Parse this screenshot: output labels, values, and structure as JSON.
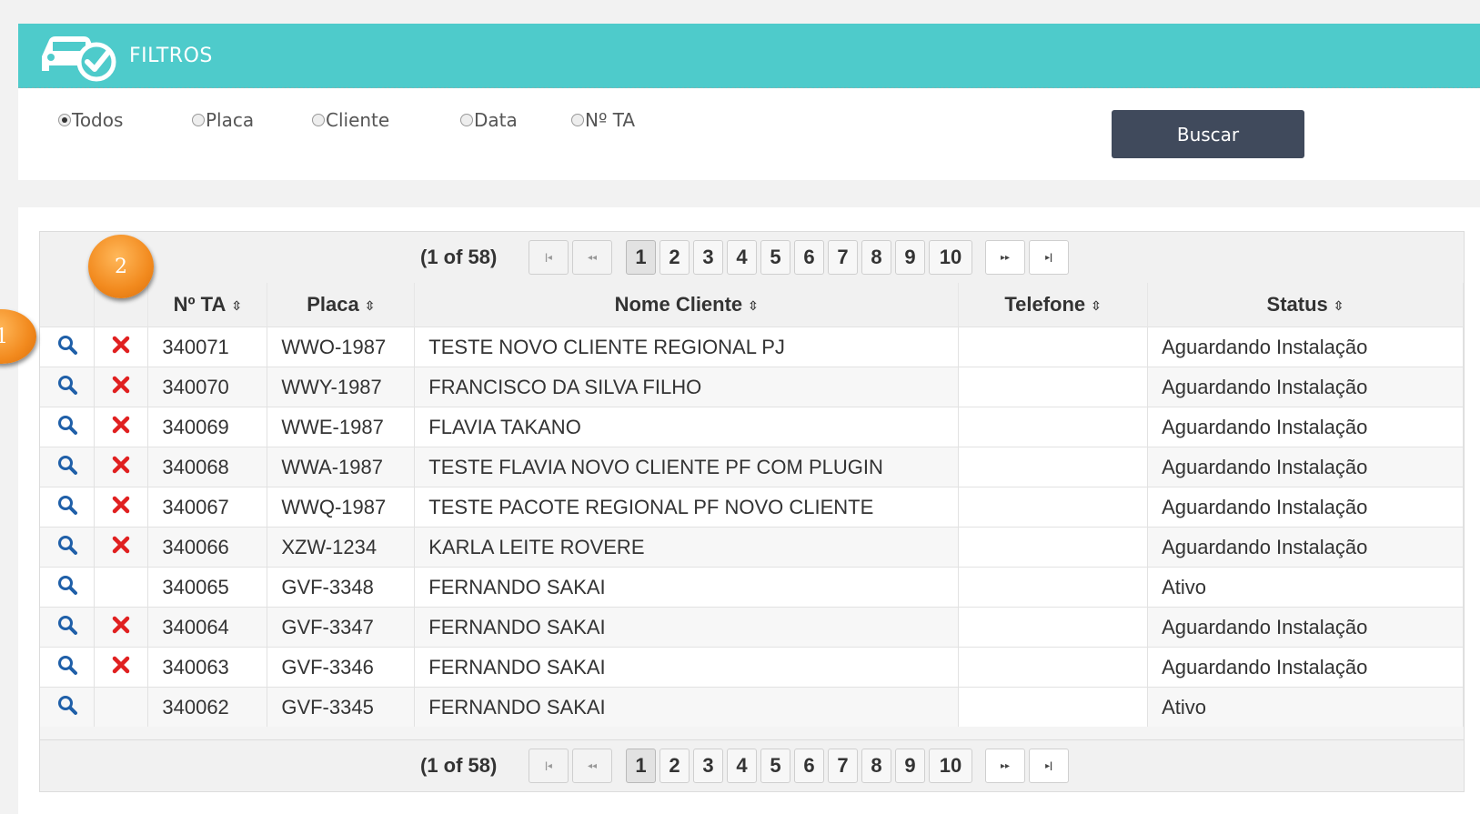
{
  "filters": {
    "title": "FILTROS",
    "options": [
      {
        "label": "Todos",
        "checked": true
      },
      {
        "label": "Placa",
        "checked": false
      },
      {
        "label": "Cliente",
        "checked": false
      },
      {
        "label": "Data",
        "checked": false
      },
      {
        "label": "Nº TA",
        "checked": false
      }
    ],
    "search_button": "Buscar"
  },
  "paginator": {
    "report": "(1 of 58)",
    "pages": [
      "1",
      "2",
      "3",
      "4",
      "5",
      "6",
      "7",
      "8",
      "9",
      "10"
    ],
    "current_page": "1",
    "first_glyph": "|◂",
    "prev_glyph": "◂◂",
    "next_glyph": "▸▸",
    "last_glyph": "▸|"
  },
  "table": {
    "columns": [
      "Nº TA",
      "Placa",
      "Nome Cliente",
      "Telefone",
      "Status"
    ],
    "sort_glyph": "⇳",
    "rows": [
      {
        "ta": "340071",
        "placa": "WWO-1987",
        "nome": "TESTE NOVO CLIENTE REGIONAL PJ",
        "telefone": "",
        "status": "Aguardando Instalação",
        "can_delete": true
      },
      {
        "ta": "340070",
        "placa": "WWY-1987",
        "nome": "FRANCISCO DA SILVA FILHO",
        "telefone": "",
        "status": "Aguardando Instalação",
        "can_delete": true
      },
      {
        "ta": "340069",
        "placa": "WWE-1987",
        "nome": "FLAVIA TAKANO",
        "telefone": "",
        "status": "Aguardando Instalação",
        "can_delete": true
      },
      {
        "ta": "340068",
        "placa": "WWA-1987",
        "nome": "TESTE FLAVIA NOVO CLIENTE PF COM PLUGIN",
        "telefone": "",
        "status": "Aguardando Instalação",
        "can_delete": true
      },
      {
        "ta": "340067",
        "placa": "WWQ-1987",
        "nome": "TESTE PACOTE REGIONAL PF NOVO CLIENTE",
        "telefone": "",
        "status": "Aguardando Instalação",
        "can_delete": true
      },
      {
        "ta": "340066",
        "placa": "XZW-1234",
        "nome": "KARLA LEITE ROVERE",
        "telefone": "",
        "status": "Aguardando Instalação",
        "can_delete": true
      },
      {
        "ta": "340065",
        "placa": "GVF-3348",
        "nome": "FERNANDO SAKAI",
        "telefone": "",
        "status": "Ativo",
        "can_delete": false
      },
      {
        "ta": "340064",
        "placa": "GVF-3347",
        "nome": "FERNANDO SAKAI",
        "telefone": "",
        "status": "Aguardando Instalação",
        "can_delete": true
      },
      {
        "ta": "340063",
        "placa": "GVF-3346",
        "nome": "FERNANDO SAKAI",
        "telefone": "",
        "status": "Aguardando Instalação",
        "can_delete": true
      },
      {
        "ta": "340062",
        "placa": "GVF-3345",
        "nome": "FERNANDO SAKAI",
        "telefone": "",
        "status": "Ativo",
        "can_delete": false
      }
    ]
  },
  "annotations": {
    "badge_1": "1",
    "badge_2": "2"
  },
  "icons": {
    "view": "search-icon",
    "delete": "delete-x-icon",
    "header": "car-check-icon"
  },
  "colors": {
    "header_bg": "#4ecbcb",
    "button_bg": "#404a5c",
    "view_icon": "#1f5fa8",
    "delete_icon": "#e02020",
    "badge": "#f28a1e"
  }
}
